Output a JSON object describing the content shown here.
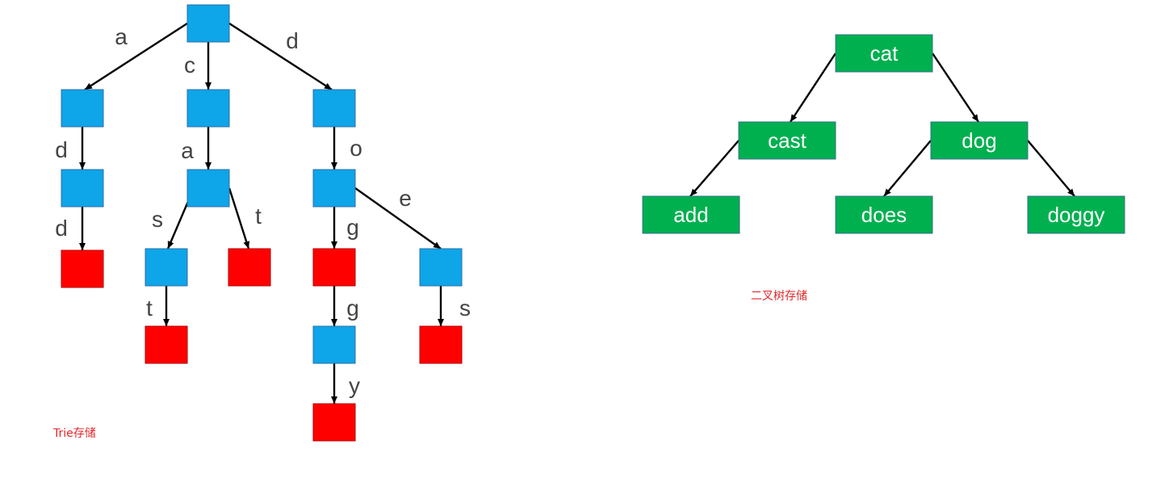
{
  "colors": {
    "inner_node": "#0ea5e9",
    "terminal_node": "#ff0000",
    "tree_node": "#00b04f",
    "edge": "#000000",
    "edge_label": "#444444",
    "caption": "#e3262b"
  },
  "trie": {
    "caption": "Trie存储",
    "nodes": [
      {
        "id": "root",
        "terminal": false
      },
      {
        "id": "a",
        "terminal": false
      },
      {
        "id": "c",
        "terminal": false
      },
      {
        "id": "d",
        "terminal": false
      },
      {
        "id": "ad",
        "terminal": false
      },
      {
        "id": "add",
        "terminal": true
      },
      {
        "id": "ca",
        "terminal": false
      },
      {
        "id": "cas",
        "terminal": false
      },
      {
        "id": "cast",
        "terminal": true
      },
      {
        "id": "cat",
        "terminal": true
      },
      {
        "id": "do",
        "terminal": false
      },
      {
        "id": "dog",
        "terminal": true
      },
      {
        "id": "dogg",
        "terminal": false
      },
      {
        "id": "doggy",
        "terminal": true
      },
      {
        "id": "doe",
        "terminal": false
      },
      {
        "id": "does",
        "terminal": true
      }
    ],
    "edges": [
      {
        "from": "root",
        "to": "a",
        "label": "a"
      },
      {
        "from": "root",
        "to": "c",
        "label": "c"
      },
      {
        "from": "root",
        "to": "d",
        "label": "d"
      },
      {
        "from": "a",
        "to": "ad",
        "label": "d"
      },
      {
        "from": "ad",
        "to": "add",
        "label": "d"
      },
      {
        "from": "c",
        "to": "ca",
        "label": "a"
      },
      {
        "from": "ca",
        "to": "cas",
        "label": "s"
      },
      {
        "from": "cas",
        "to": "cast",
        "label": "t"
      },
      {
        "from": "ca",
        "to": "cat",
        "label": "t"
      },
      {
        "from": "d",
        "to": "do",
        "label": "o"
      },
      {
        "from": "do",
        "to": "dog",
        "label": "g"
      },
      {
        "from": "dog",
        "to": "dogg",
        "label": "g"
      },
      {
        "from": "dogg",
        "to": "doggy",
        "label": "y"
      },
      {
        "from": "do",
        "to": "doe",
        "label": "e"
      },
      {
        "from": "doe",
        "to": "does",
        "label": "s"
      }
    ]
  },
  "binary_tree": {
    "caption": "二叉树存储",
    "nodes": [
      {
        "id": "cat",
        "label": "cat"
      },
      {
        "id": "cast",
        "label": "cast"
      },
      {
        "id": "dog",
        "label": "dog"
      },
      {
        "id": "add",
        "label": "add"
      },
      {
        "id": "does",
        "label": "does"
      },
      {
        "id": "doggy",
        "label": "doggy"
      }
    ],
    "edges": [
      {
        "from": "cat",
        "to": "cast"
      },
      {
        "from": "cat",
        "to": "dog"
      },
      {
        "from": "cast",
        "to": "add"
      },
      {
        "from": "dog",
        "to": "does"
      },
      {
        "from": "dog",
        "to": "doggy"
      }
    ]
  }
}
